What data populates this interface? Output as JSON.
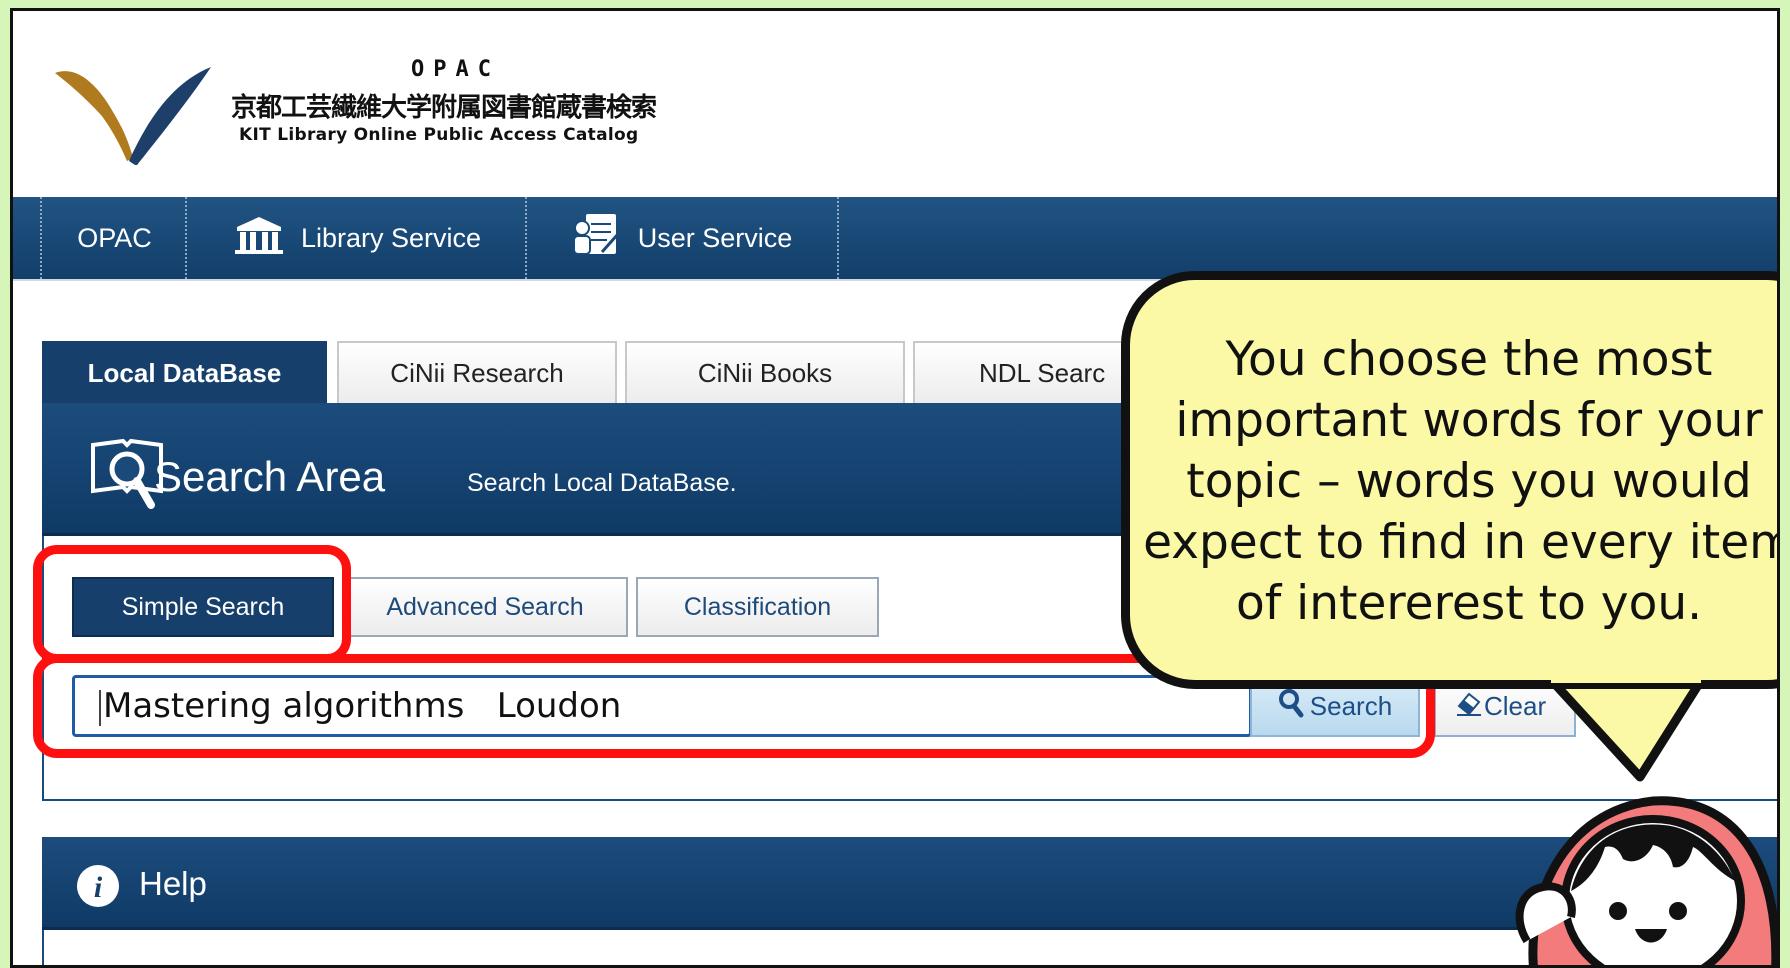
{
  "header": {
    "opac_label": "OPAC",
    "title_jp": "京都工芸繊維大学附属図書館蔵書検索",
    "title_en": "KIT Library Online Public Access Catalog",
    "logo_colors": {
      "gold": "#b07a1e",
      "navy": "#1d3f6a"
    }
  },
  "nav": {
    "items": [
      {
        "label": "OPAC",
        "icon": ""
      },
      {
        "label": "Library Service",
        "icon": "library-building-icon"
      },
      {
        "label": "User Service",
        "icon": "user-service-icon"
      }
    ]
  },
  "tabs": [
    {
      "label": "Local DataBase",
      "active": true
    },
    {
      "label": "CiNii Research",
      "active": false
    },
    {
      "label": "CiNii Books",
      "active": false
    },
    {
      "label": "NDL Searc",
      "active": false
    }
  ],
  "search_area": {
    "title": "Search Area",
    "subtitle": "Search Local DataBase.",
    "icon": "book-magnifier-icon",
    "modes": [
      {
        "label": "Simple Search",
        "active": true
      },
      {
        "label": "Advanced Search",
        "active": false
      },
      {
        "label": "Classification",
        "active": false
      }
    ],
    "query_value": "Mastering algorithms   Loudon",
    "search_button": "Search",
    "clear_button": "Clear"
  },
  "help": {
    "label": "Help",
    "icon": "info-icon"
  },
  "callout": {
    "text": "You choose the most important words for your topic – words you would expect to find in every item of intererest to you."
  },
  "colors": {
    "background": "#d6f5b8",
    "primary_navy": "#163f6b",
    "highlight_red": "#ff1010",
    "bubble_yellow": "#fcf9a6",
    "character_pink": "#f47b7b"
  }
}
